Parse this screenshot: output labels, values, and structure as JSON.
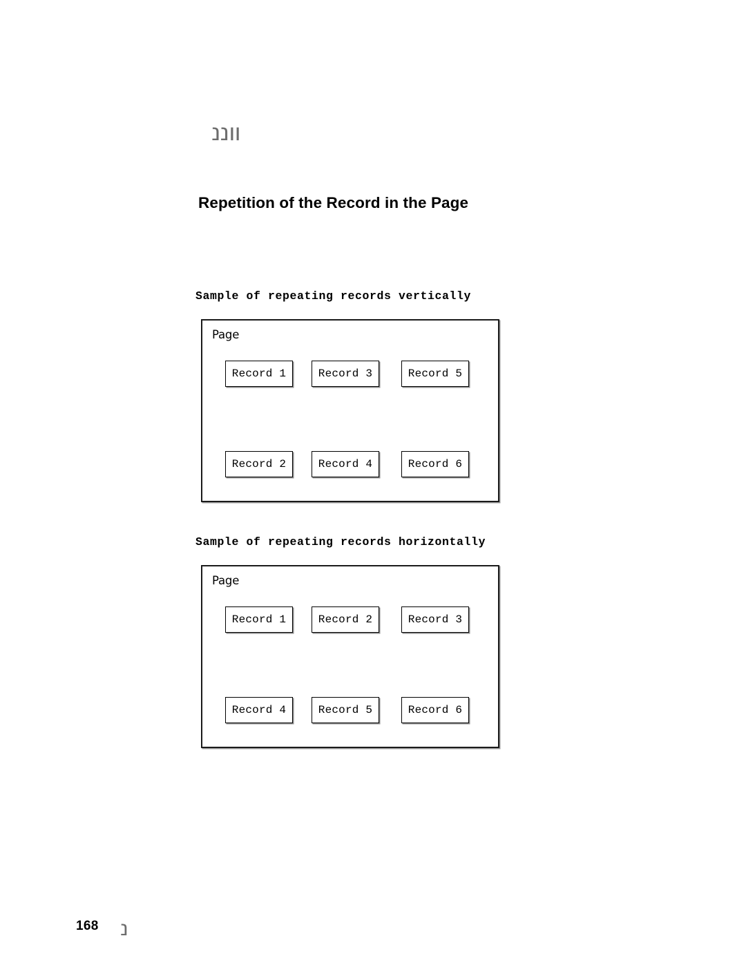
{
  "document": {
    "title": "Repetition of the Record in the Page",
    "page_number": "168",
    "top_artifact_upper": "┘",
    "top_artifact_lower": "ווננ",
    "footer_artifact": "נ"
  },
  "figures": [
    {
      "caption": "Sample of repeating records vertically",
      "frame_label": "Page",
      "order": "vertical",
      "rows": [
        [
          "Record 1",
          "Record 3",
          "Record 5"
        ],
        [
          "Record 2",
          "Record 4",
          "Record 6"
        ]
      ]
    },
    {
      "caption": "Sample of repeating records horizontally",
      "frame_label": "Page",
      "order": "horizontal",
      "rows": [
        [
          "Record 1",
          "Record 2",
          "Record 3"
        ],
        [
          "Record 4",
          "Record 5",
          "Record 6"
        ]
      ]
    }
  ],
  "colors": {
    "background": "#ffffff",
    "text": "#000000",
    "frame_border": "#1a1a1a",
    "box_border": "#000000",
    "shadow": "#8c8c8c",
    "artifact": "#6d6d6d"
  }
}
